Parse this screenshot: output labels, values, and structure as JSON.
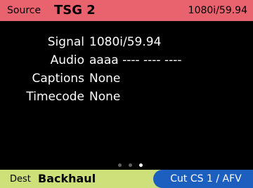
{
  "header": {
    "source_label": "Source",
    "source_name": "TSG 2",
    "format": "1080i/59.94",
    "background_color": "#e8636d"
  },
  "details": [
    {
      "label": "Signal",
      "value": "1080i/59.94"
    },
    {
      "label": "Audio",
      "value": "aaaa ---- ---- ----"
    },
    {
      "label": "Captions",
      "value": "None"
    },
    {
      "label": "Timecode",
      "value": "None"
    }
  ],
  "pager": {
    "page_count": 3,
    "active_page": 3
  },
  "footer": {
    "dest_label": "Dest",
    "dest_name": "Backhaul",
    "action_label": "Cut CS 1 / AFV",
    "background_color": "#cde07a",
    "action_color": "#1d5fbf"
  }
}
